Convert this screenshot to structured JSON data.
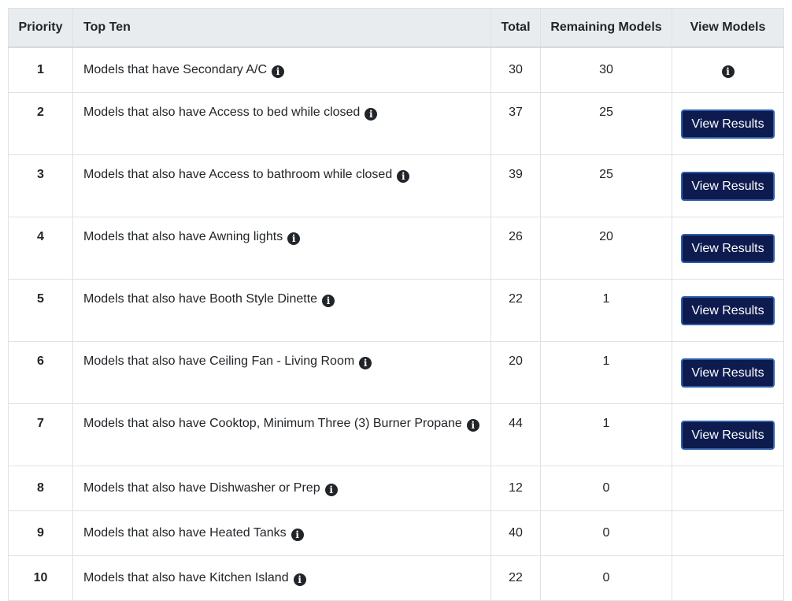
{
  "table": {
    "headers": {
      "priority": "Priority",
      "top_ten": "Top Ten",
      "total": "Total",
      "remaining": "Remaining Models",
      "view": "View Models"
    },
    "info_icon_glyph": "i",
    "button_label": "View Results",
    "rows": [
      {
        "priority": "1",
        "label": "Models that have Secondary A/C",
        "total": "30",
        "remaining": "30"
      },
      {
        "priority": "2",
        "label": "Models that also have Access to bed while closed",
        "total": "37",
        "remaining": "25"
      },
      {
        "priority": "3",
        "label": "Models that also have Access to bathroom while closed",
        "total": "39",
        "remaining": "25"
      },
      {
        "priority": "4",
        "label": "Models that also have Awning lights",
        "total": "26",
        "remaining": "20"
      },
      {
        "priority": "5",
        "label": "Models that also have Booth Style Dinette",
        "total": "22",
        "remaining": "1"
      },
      {
        "priority": "6",
        "label": "Models that also have Ceiling Fan - Living Room",
        "total": "20",
        "remaining": "1"
      },
      {
        "priority": "7",
        "label": "Models that also have Cooktop, Minimum Three (3) Burner Propane",
        "total": "44",
        "remaining": "1"
      },
      {
        "priority": "8",
        "label": "Models that also have Dishwasher or Prep",
        "total": "12",
        "remaining": "0"
      },
      {
        "priority": "9",
        "label": "Models that also have Heated Tanks",
        "total": "40",
        "remaining": "0"
      },
      {
        "priority": "10",
        "label": "Models that also have Kitchen Island",
        "total": "22",
        "remaining": "0"
      }
    ]
  },
  "colors": {
    "header_bg": "#e9ecef",
    "button_bg": "#0d1b4f",
    "button_border": "#2d5ea8",
    "border": "#dee2e6",
    "text": "#212529"
  }
}
